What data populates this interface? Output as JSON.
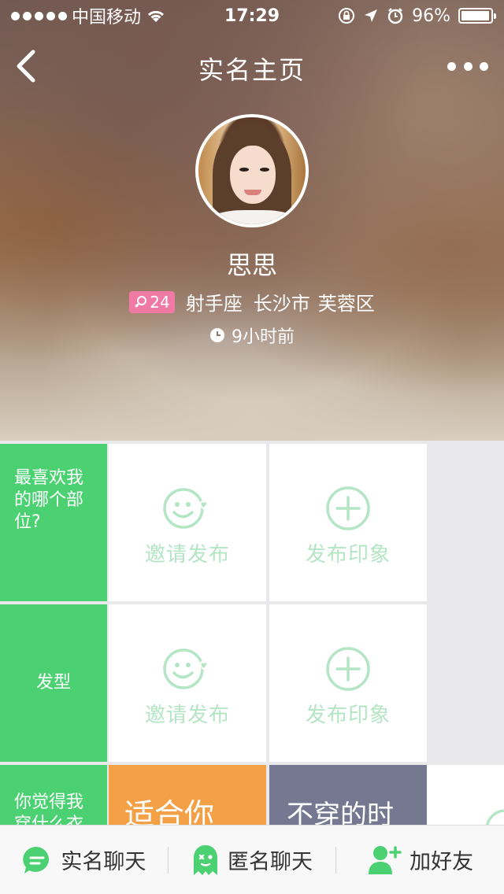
{
  "status_bar": {
    "carrier": "中国移动",
    "time": "17:29",
    "battery": "96%",
    "battery_level": 0.96
  },
  "nav": {
    "title": "实名主页"
  },
  "profile": {
    "name": "思思",
    "age": "24",
    "zodiac": "射手座",
    "city": "长沙市",
    "district": "芙蓉区",
    "last_active": "9小时前"
  },
  "grid": {
    "rows": [
      {
        "question": "最喜欢我的哪个部位?",
        "invite_label": "邀请发布",
        "publish_label": "发布印象"
      },
      {
        "question": "发型",
        "invite_label": "邀请发布",
        "publish_label": "发布印象"
      },
      {
        "question": "你觉得我穿什么衣",
        "tile_1": "适合你",
        "tile_2": "不穿的时"
      }
    ]
  },
  "bottom_bar": {
    "real_chat": "实名聊天",
    "anon_chat": "匿名聊天",
    "add_friend": "加好友"
  },
  "colors": {
    "green": "#4cd172",
    "light_green": "#b4e5c5",
    "pink_badge": "#f07aa3",
    "orange": "#f4a046",
    "slate": "#747891"
  },
  "icons": {
    "back": "chevron-left-icon",
    "more": "more-dots-icon",
    "clock": "clock-icon",
    "smile_heart": "smile-heart-icon",
    "plus_circle": "plus-circle-icon",
    "chat_bubble": "chat-bubble-icon",
    "ghost": "ghost-icon",
    "add_user": "add-user-icon"
  }
}
